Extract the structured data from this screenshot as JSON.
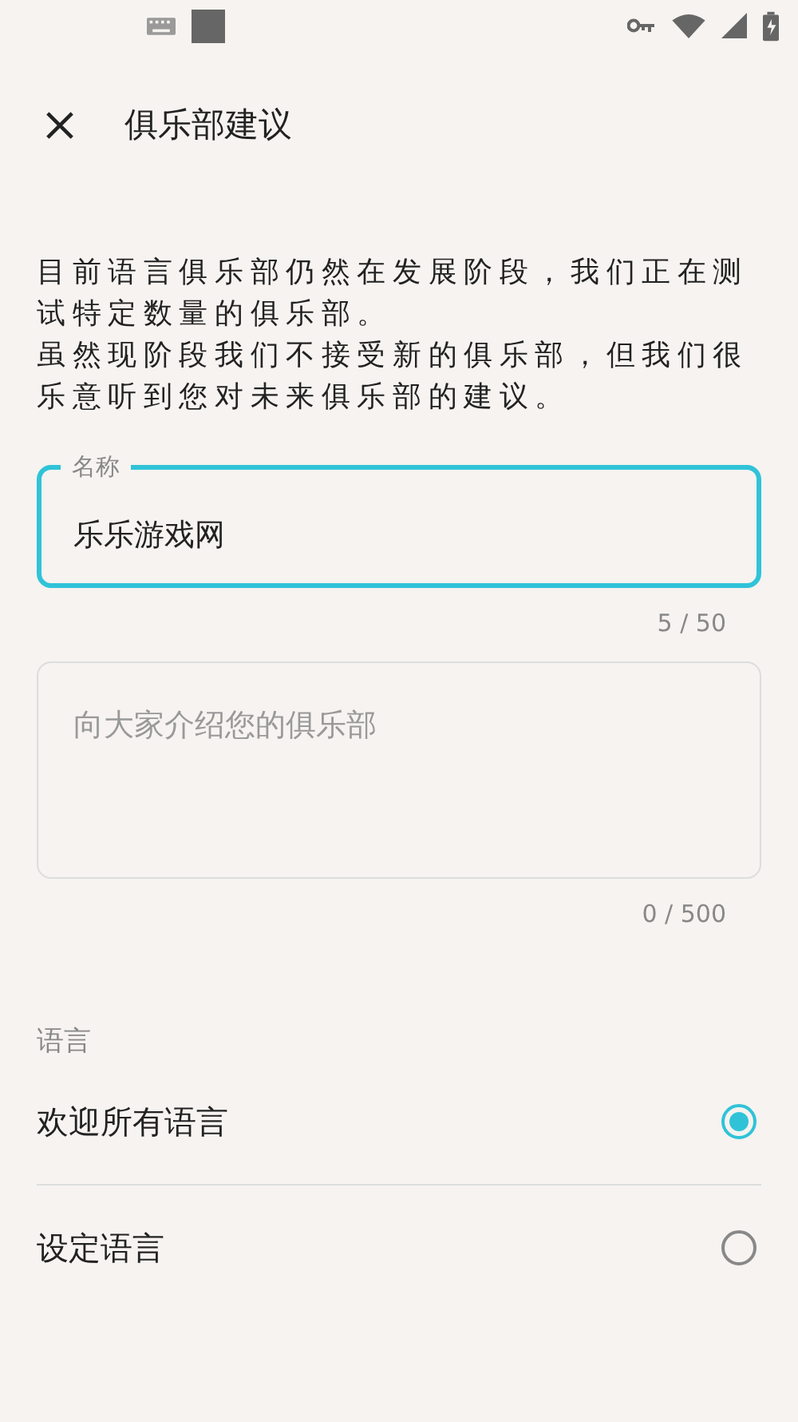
{
  "app_bar": {
    "title": "俱乐部建议"
  },
  "description": [
    "目前语言俱乐部仍然在发展阶段，我们正在测试特定数量的俱乐部。",
    "虽然现阶段我们不接受新的俱乐部，但我们很乐意听到您对未来俱乐部的建议。"
  ],
  "name_field": {
    "label": "名称",
    "value": "乐乐游戏网",
    "focused": true,
    "counter": "5 / 50"
  },
  "intro_field": {
    "placeholder": "向大家介绍您的俱乐部",
    "counter": "0 / 500"
  },
  "language": {
    "heading": "语言",
    "options": [
      {
        "label": "欢迎所有语言",
        "selected": true
      },
      {
        "label": "设定语言",
        "selected": false
      }
    ]
  }
}
